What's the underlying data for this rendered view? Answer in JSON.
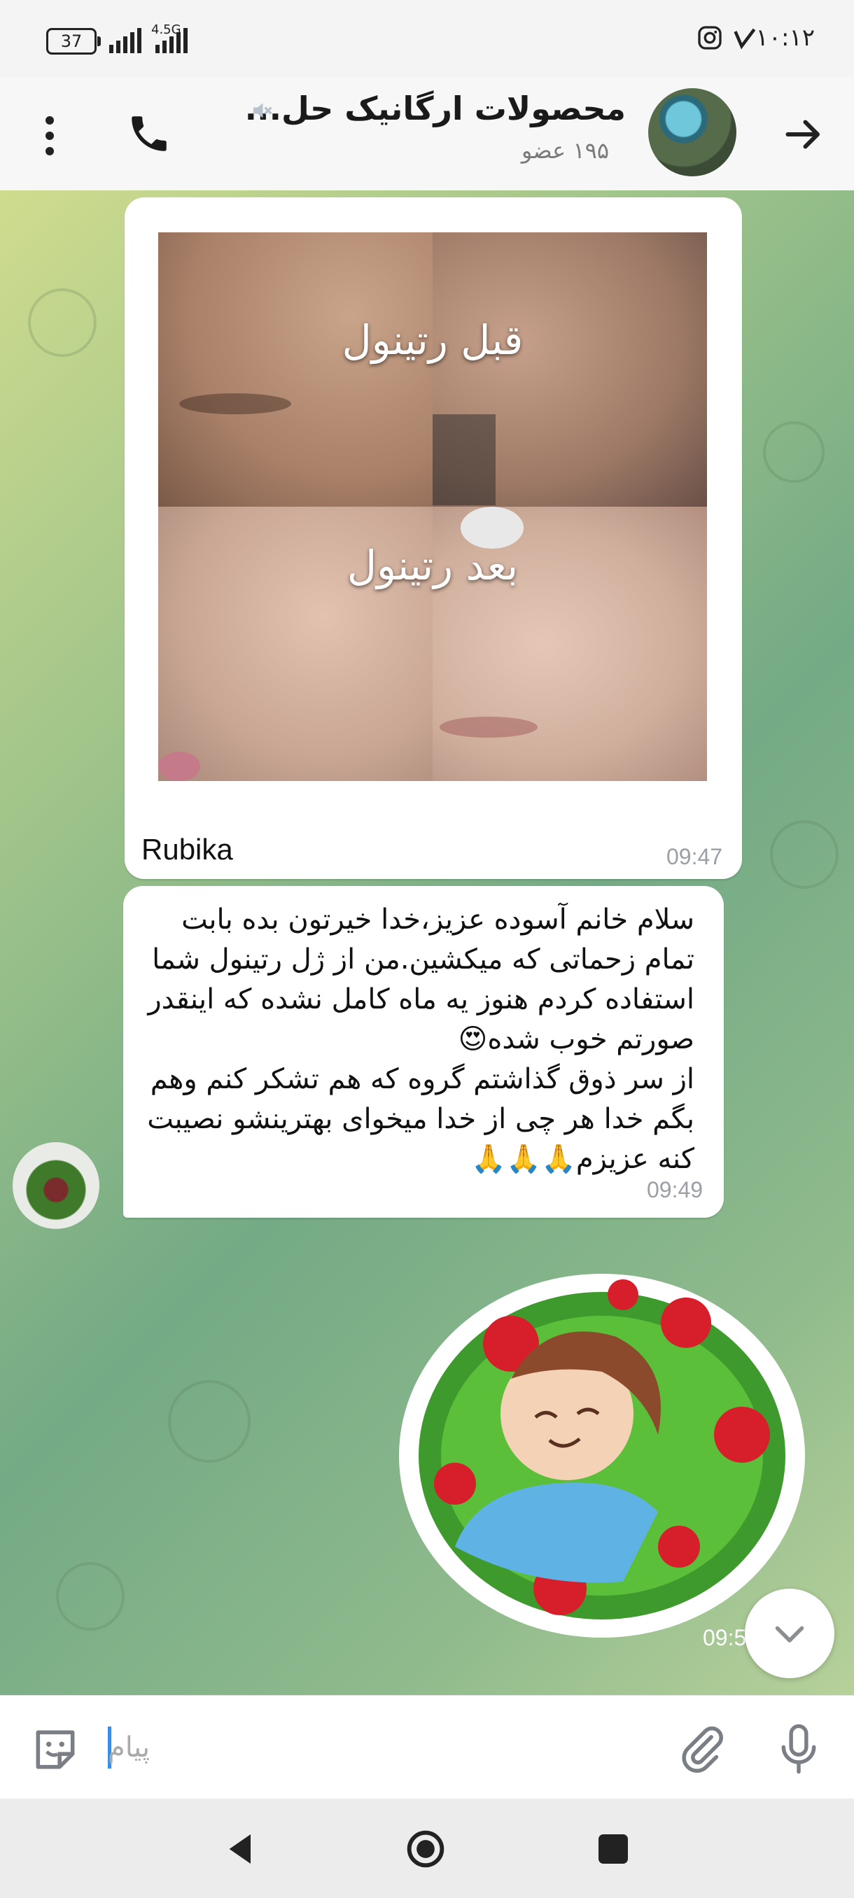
{
  "status_bar": {
    "battery": "37",
    "network": "4.5G",
    "time": "۱۰:۱۲"
  },
  "header": {
    "title": "محصولات ارگانیک حل...",
    "members": "۱۹۵ عضو"
  },
  "messages": [
    {
      "type": "photo",
      "photo_labels": [
        "قبل رتینول",
        "بعد رتینول"
      ],
      "caption": "Rubika",
      "time": "09:47"
    },
    {
      "type": "text",
      "text": "سلام خانم آسوده عزیز،خدا خیرتون بده بابت تمام زحماتی که میکشین.من از ژل رتینول شما استفاده کردم هنوز یه ماه کامل نشده که اینقدر صورتم خوب شده😍\nاز سر ذوق گذاشتم گروه که هم تشکر کنم وهم بگم خدا هر چی از خدا میخوای بهترینشو نصیبت کنه عزیزم🙏🙏🙏",
      "time": "09:49"
    },
    {
      "type": "sticker",
      "time": "09:5"
    }
  ],
  "input": {
    "placeholder": "پیام"
  },
  "icons": {
    "back": "arrow-right-icon",
    "call": "phone-icon",
    "menu": "more-vertical-icon",
    "mute": "muted-speaker-icon",
    "emoji": "sticker-smile-icon",
    "attach": "paperclip-icon",
    "mic": "microphone-icon",
    "scroll_down": "chevron-down-icon"
  }
}
